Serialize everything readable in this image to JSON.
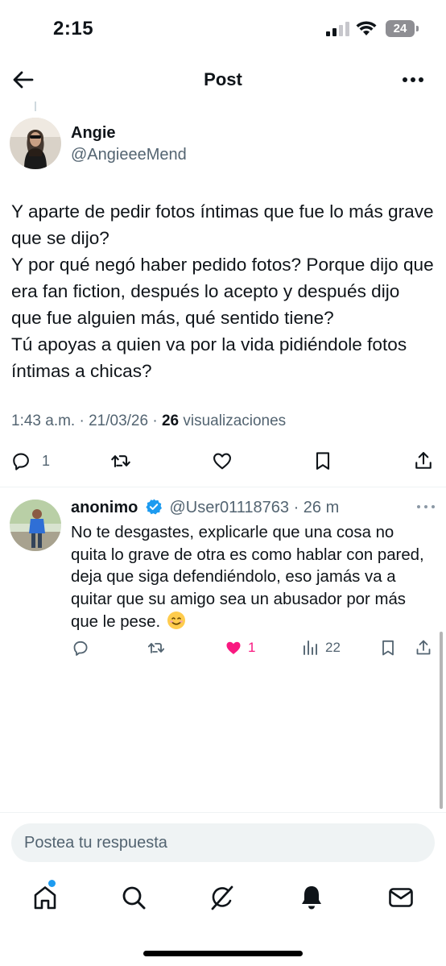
{
  "status_bar": {
    "time": "2:15",
    "battery": "24"
  },
  "header": {
    "title": "Post"
  },
  "post": {
    "author_name": "Angie",
    "author_handle": "@AngieeeMend",
    "text_lines": [
      "Y aparte de pedir fotos íntimas que fue lo más grave que se dijo?",
      "Y por qué negó haber pedido fotos? Porque dijo que era fan fiction, después lo acepto y después dijo que fue alguien más, qué sentido tiene?",
      "Tú apoyas a quien va por la vida pidiéndole fotos íntimas a chicas?"
    ],
    "time": "1:43 a.m.",
    "date": "21/03/26",
    "views": "26",
    "views_label": "visualizaciones",
    "reply_count": "1"
  },
  "reply": {
    "name": "anonimo",
    "handle": "@User01118763",
    "age": "26 m",
    "text": "No te desgastes, explicarle que una cosa no quita lo grave de otra es como hablar con pared, deja que siga defendiéndolo, eso jamás va a quitar que su amigo sea un abusador por más que le pese.",
    "like_count": "1",
    "view_count": "22"
  },
  "compose": {
    "placeholder": "Postea tu respuesta"
  },
  "colors": {
    "accent": "#1d9bf0",
    "like": "#f91880",
    "text": "#0f1419",
    "secondary": "#536471"
  },
  "icons": [
    "back-arrow-icon",
    "more-icon",
    "reply-icon",
    "repost-icon",
    "like-icon",
    "bookmark-icon",
    "share-icon",
    "views-icon",
    "verified-icon",
    "home-icon",
    "search-icon",
    "grok-icon",
    "notifications-icon",
    "messages-icon"
  ]
}
